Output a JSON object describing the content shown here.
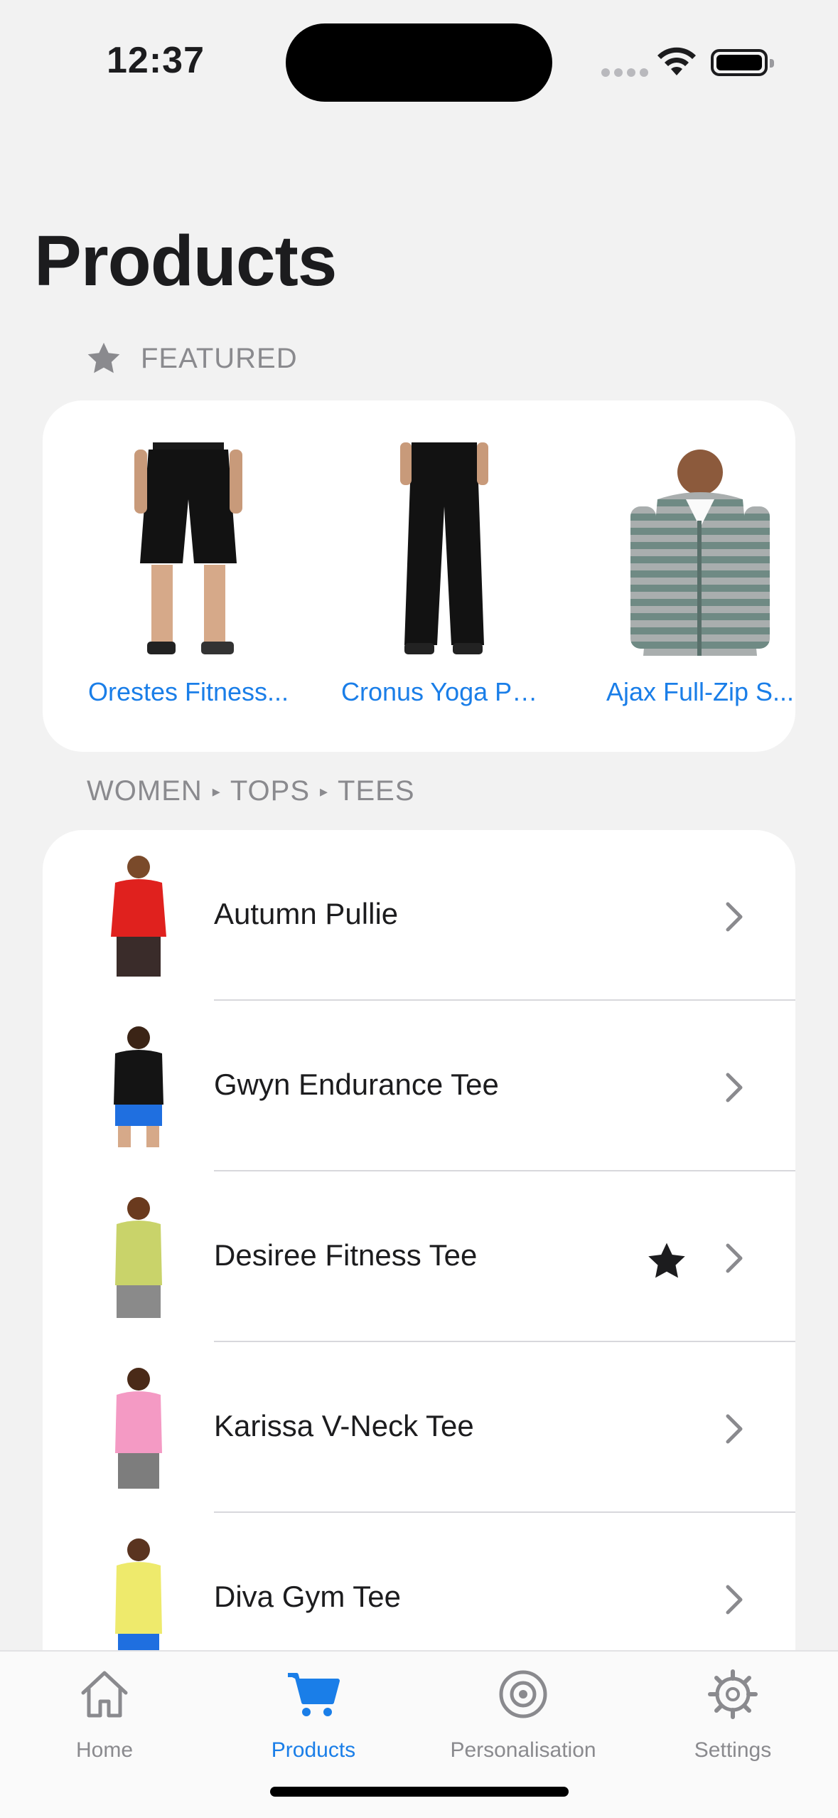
{
  "status": {
    "time": "12:37"
  },
  "title": "Products",
  "featured": {
    "header": "FEATURED",
    "icon": "star-icon",
    "items": [
      {
        "label": "Orestes Fitness...",
        "image": "black-shorts"
      },
      {
        "label": "Cronus Yoga Pa...",
        "image": "black-pants"
      },
      {
        "label": "Ajax Full-Zip S...",
        "image": "striped-hoodie"
      }
    ]
  },
  "breadcrumb": {
    "items": [
      "WOMEN",
      "TOPS",
      "TEES"
    ]
  },
  "products": [
    {
      "name": "Autumn Pullie",
      "favorite": false,
      "colors": {
        "top": "#e0211e",
        "bottom": "#3a2c2a"
      }
    },
    {
      "name": "Gwyn Endurance Tee",
      "favorite": false,
      "colors": {
        "top": "#141414",
        "bottom": "#1f6fe0"
      }
    },
    {
      "name": "Desiree Fitness Tee",
      "favorite": true,
      "colors": {
        "top": "#c9d36a",
        "bottom": "#8a8a8a"
      }
    },
    {
      "name": "Karissa V-Neck Tee",
      "favorite": false,
      "colors": {
        "top": "#f49ac4",
        "bottom": "#7d7d7d"
      }
    },
    {
      "name": "Diva Gym Tee",
      "favorite": false,
      "colors": {
        "top": "#eeea6c",
        "bottom": "#1f6fe0"
      }
    }
  ],
  "tabs": [
    {
      "label": "Home",
      "icon": "house-icon",
      "active": false
    },
    {
      "label": "Products",
      "icon": "cart-icon",
      "active": true
    },
    {
      "label": "Personalisation",
      "icon": "target-icon",
      "active": false
    },
    {
      "label": "Settings",
      "icon": "gear-icon",
      "active": false
    }
  ],
  "colors": {
    "accent": "#1a7ee8",
    "secondary_text": "#8a8a8e",
    "background": "#f2f2f2"
  }
}
